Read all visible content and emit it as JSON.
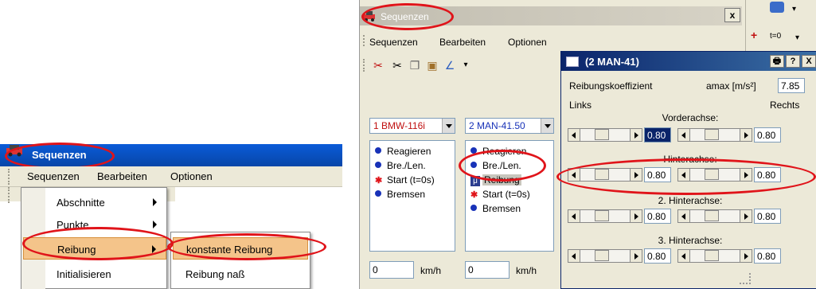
{
  "left": {
    "title": "Sequenzen",
    "menu": [
      "Sequenzen",
      "Bearbeiten",
      "Optionen"
    ],
    "popup_items": [
      {
        "label": "Abschnitte",
        "submenu": true
      },
      {
        "label": "Punkte",
        "submenu": true
      },
      {
        "label": "Reibung",
        "submenu": true
      },
      {
        "label": "Initialisieren",
        "submenu": false
      }
    ],
    "submenu_items": [
      "konstante Reibung",
      "Reibung naß"
    ]
  },
  "right": {
    "title": "Sequenzen",
    "close": "x",
    "menu": [
      "Sequenzen",
      "Bearbeiten",
      "Optionen"
    ],
    "side_label": "t=0",
    "vehicle1": {
      "name": "1 BMW-116i",
      "color": "#c01010",
      "items": [
        {
          "icon": "dot",
          "label": "Reagieren"
        },
        {
          "icon": "dot",
          "label": "Bre./Len."
        },
        {
          "icon": "cross",
          "label": "Start (t=0s)"
        },
        {
          "icon": "dot",
          "label": "Bremsen"
        }
      ],
      "speed": "0",
      "unit": "km/h"
    },
    "vehicle2": {
      "name": "2 MAN-41.50",
      "color": "#1832b8",
      "items": [
        {
          "icon": "dot",
          "label": "Reagieren"
        },
        {
          "icon": "dot",
          "label": "Bre./Len."
        },
        {
          "icon": "mu",
          "label": "Reibung"
        },
        {
          "icon": "cross",
          "label": "Start (t=0s)"
        },
        {
          "icon": "dot",
          "label": "Bremsen"
        }
      ],
      "speed": "0",
      "unit": "km/h"
    },
    "dialog": {
      "title": "(2 MAN-41)",
      "buttons": [
        "🖶",
        "?",
        "X"
      ],
      "label_coef": "Reibungskoeffizient",
      "label_amax": "amax [m/s²]",
      "amax_value": "7.85",
      "links": "Links",
      "rechts": "Rechts",
      "axles": [
        {
          "name": "Vorderachse:",
          "left": "0.80",
          "right": "0.80"
        },
        {
          "name": "Hinterachse:",
          "left": "0.80",
          "right": "0.80"
        },
        {
          "name": "2. Hinterachse:",
          "left": "0.80",
          "right": "0.80"
        },
        {
          "name": "3. Hinterachse:",
          "left": "0.80",
          "right": "0.80"
        }
      ]
    }
  }
}
